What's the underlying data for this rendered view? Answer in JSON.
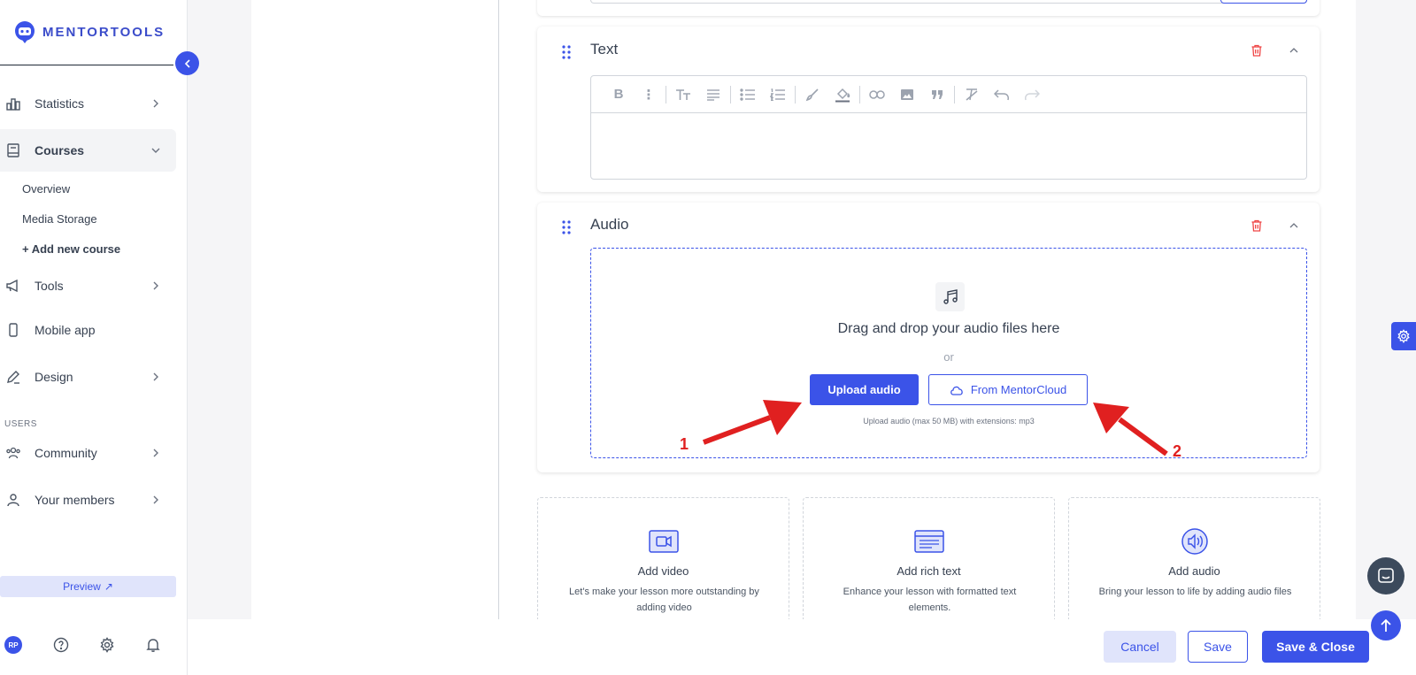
{
  "brand": {
    "name": "MENTORTOOLS"
  },
  "sidebar": {
    "items": [
      {
        "label": "Statistics",
        "icon": "bar-chart-icon",
        "has_chevron": true
      },
      {
        "label": "Courses",
        "icon": "book-icon",
        "active": true,
        "expanded": true
      },
      {
        "label": "Tools",
        "icon": "megaphone-icon",
        "has_chevron": true
      },
      {
        "label": "Mobile app",
        "icon": "phone-icon",
        "has_chevron": false
      },
      {
        "label": "Design",
        "icon": "pencil-icon",
        "has_chevron": true
      },
      {
        "label": "Community",
        "icon": "users-icon",
        "has_chevron": true
      },
      {
        "label": "Your members",
        "icon": "user-icon",
        "has_chevron": true
      }
    ],
    "sub_items": [
      "Overview",
      "Media Storage",
      "+ Add new course"
    ],
    "section_users": "USERS",
    "preview_label": "Preview",
    "avatar_initials": "RP"
  },
  "blocks": {
    "text": {
      "title": "Text",
      "toolbar": [
        "bold-icon",
        "more-icon",
        "text-size-icon",
        "align-icon",
        "bullet-list-icon",
        "numbered-list-icon",
        "brush-icon",
        "fill-color-icon",
        "link-icon",
        "image-icon",
        "quote-icon",
        "clear-format-icon",
        "undo-icon",
        "redo-icon"
      ]
    },
    "audio": {
      "title": "Audio",
      "drop_title": "Drag and drop your audio files here",
      "or": "or",
      "upload_label": "Upload audio",
      "cloud_label": "From MentorCloud",
      "hint": "Upload audio (max 50 MB) with extensions: mp3"
    }
  },
  "add_cards": [
    {
      "title": "Add video",
      "desc": "Let's make your lesson more outstanding by adding video",
      "icon": "video-icon"
    },
    {
      "title": "Add rich text",
      "desc": "Enhance your lesson with formatted text elements.",
      "icon": "rich-text-icon"
    },
    {
      "title": "Add audio",
      "desc": "Bring your lesson to life by adding audio files",
      "icon": "audio-icon"
    }
  ],
  "annotations": {
    "one": "1",
    "two": "2",
    "color": "#e02020"
  },
  "footer": {
    "cancel": "Cancel",
    "save": "Save",
    "save_close": "Save & Close"
  },
  "colors": {
    "accent": "#3b53e8",
    "danger": "#ef4444"
  }
}
